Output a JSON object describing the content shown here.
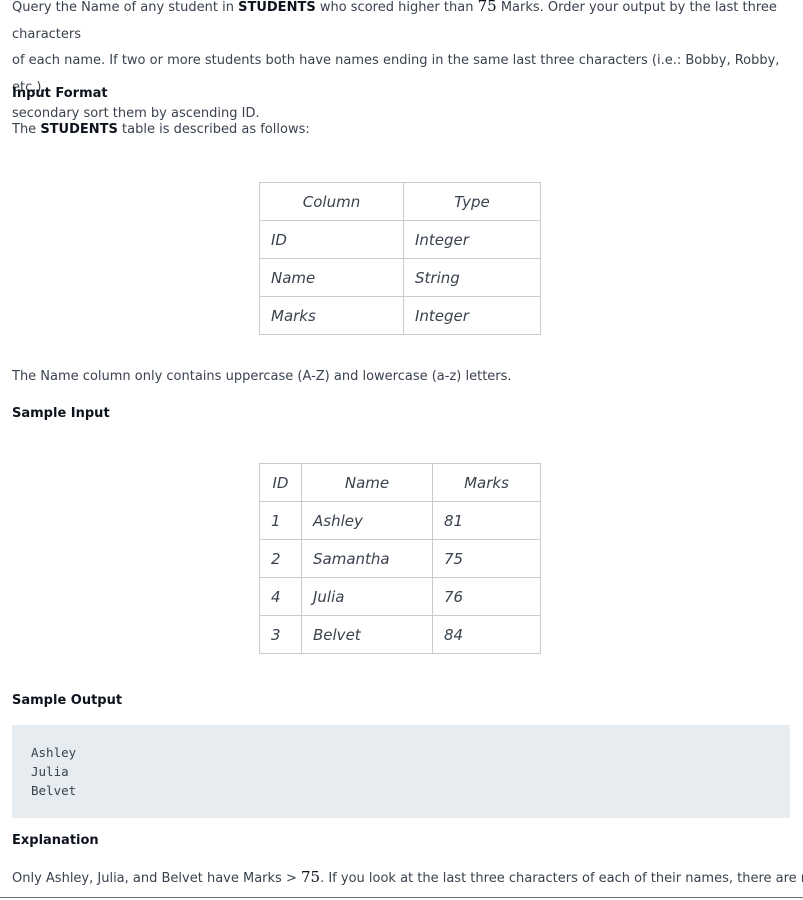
{
  "problem": {
    "line1_prefix": "Query the Name of any student in ",
    "line1_table": "STUDENTS",
    "line1_mid": " who scored higher than ",
    "line1_num": "75",
    "line1_suffix": " Marks. Order your output by the last three characters",
    "line2": "of each name. If two or more students both have names ending in the same last three characters (i.e.: Bobby, Robby, etc.),",
    "line3": "secondary sort them by ascending ID."
  },
  "input_format": {
    "title": "Input Format",
    "desc_prefix": "The ",
    "desc_table": "STUDENTS",
    "desc_suffix": " table is described as follows:"
  },
  "schema_table": {
    "headers": [
      "Column",
      "Type"
    ],
    "rows": [
      [
        "ID",
        "Integer"
      ],
      [
        "Name",
        "String"
      ],
      [
        "Marks",
        "Integer"
      ]
    ]
  },
  "name_note": "The Name column only contains uppercase (A-Z) and lowercase (a-z) letters.",
  "sample_input": {
    "title": "Sample Input",
    "headers": [
      "ID",
      "Name",
      "Marks"
    ],
    "rows": [
      [
        "1",
        "Ashley",
        "81"
      ],
      [
        "2",
        "Samantha",
        "75"
      ],
      [
        "4",
        "Julia",
        "76"
      ],
      [
        "3",
        "Belvet",
        "84"
      ]
    ]
  },
  "sample_output": {
    "title": "Sample Output",
    "lines": [
      "Ashley",
      "Julia",
      "Belvet"
    ]
  },
  "explanation": {
    "title": "Explanation",
    "text_prefix": "Only Ashley, Julia, and Belvet have Marks > ",
    "text_num": "75",
    "text_suffix": ". If you look at the last three characters of each of their names, there are no"
  }
}
